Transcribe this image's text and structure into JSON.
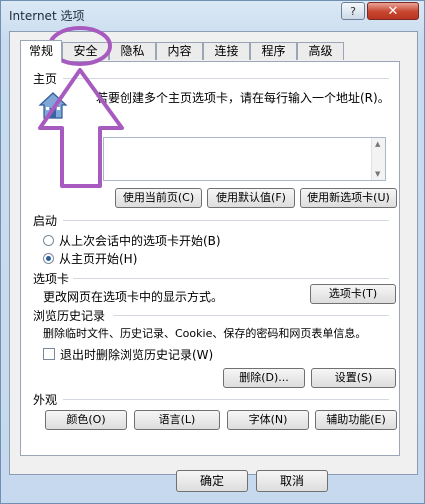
{
  "window": {
    "title": "Internet 选项",
    "help_label": "?",
    "close_label": "✕"
  },
  "tabs": [
    {
      "label": "常规",
      "active": true
    },
    {
      "label": "安全"
    },
    {
      "label": "隐私"
    },
    {
      "label": "内容"
    },
    {
      "label": "连接"
    },
    {
      "label": "程序"
    },
    {
      "label": "高级"
    }
  ],
  "home": {
    "section_title": "主页",
    "description": "若要创建多个主页选项卡，请在每行输入一个地址(R)。",
    "buttons": {
      "use_current": "使用当前页(C)",
      "use_default": "使用默认值(F)",
      "use_new_tab": "使用新选项卡(U)"
    }
  },
  "startup": {
    "section_title": "启动",
    "option_last_session": "从上次会话中的选项卡开始(B)",
    "option_home": "从主页开始(H)",
    "selected": "option_home"
  },
  "tabs_section": {
    "section_title": "选项卡",
    "description": "更改网页在选项卡中的显示方式。",
    "button": "选项卡(T)"
  },
  "history": {
    "section_title": "浏览历史记录",
    "description": "删除临时文件、历史记录、Cookie、保存的密码和网页表单信息。",
    "checkbox_label": "退出时删除浏览历史记录(W)",
    "checkbox_checked": false,
    "delete_button": "删除(D)...",
    "settings_button": "设置(S)"
  },
  "appearance": {
    "section_title": "外观",
    "colors_button": "颜色(O)",
    "languages_button": "语言(L)",
    "fonts_button": "字体(N)",
    "accessibility_button": "辅助功能(E)"
  },
  "footer": {
    "ok_button": "确定",
    "cancel_button": "取消"
  },
  "annotation": {
    "color": "#a85bbf"
  }
}
